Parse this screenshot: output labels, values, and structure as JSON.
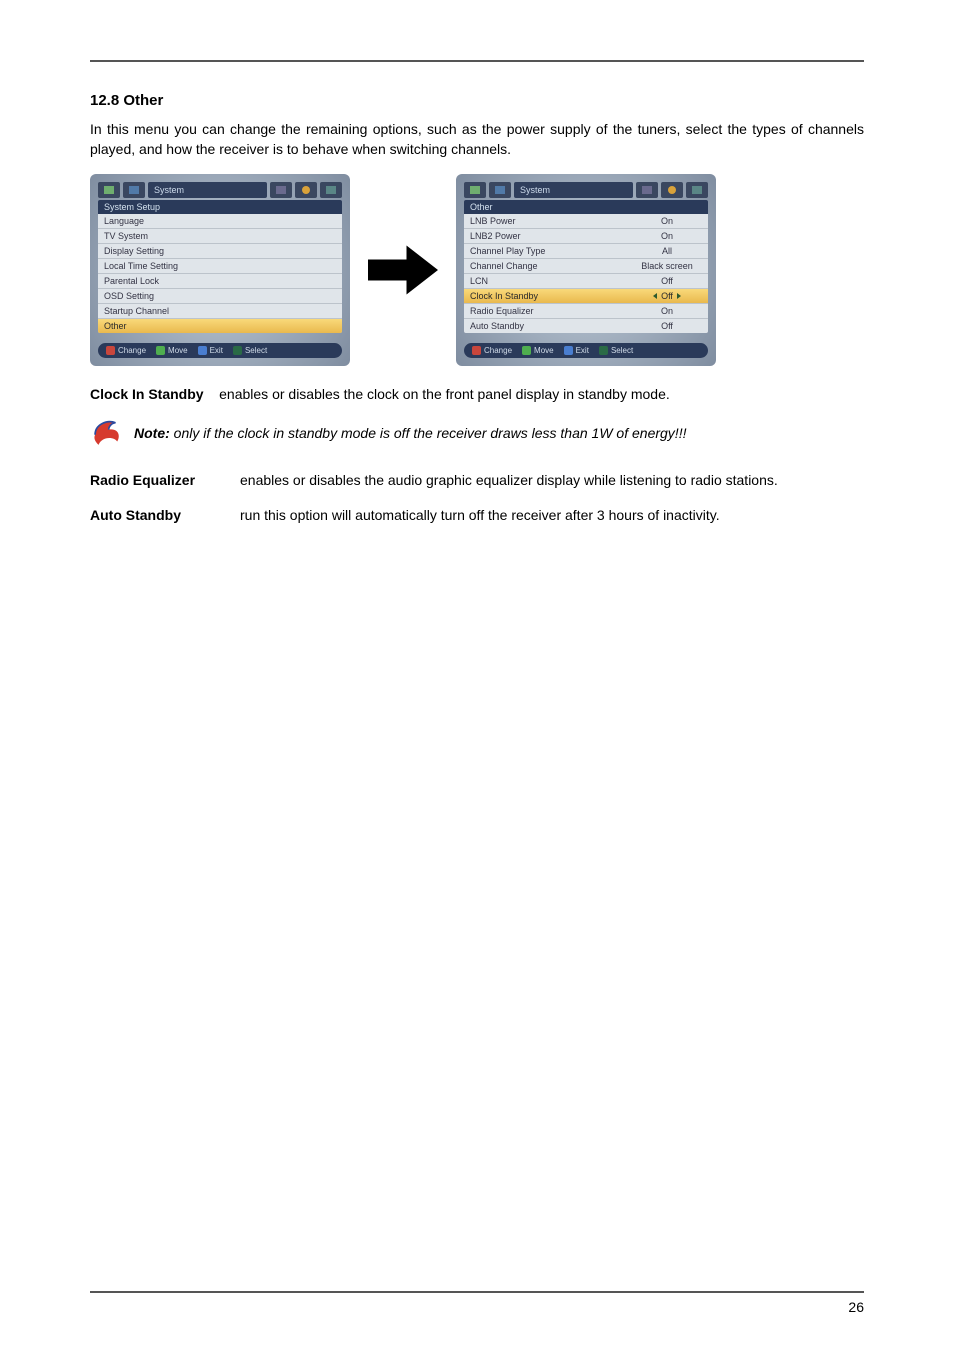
{
  "section": {
    "heading": "12.8 Other",
    "intro": "In this menu you can change the remaining options, such as the power supply of the tuners, select the types of channels played, and how the receiver is to behave when switching channels."
  },
  "left_panel": {
    "tab_group_title": "System",
    "header": "System Setup",
    "items": [
      {
        "label": "Language"
      },
      {
        "label": "TV System"
      },
      {
        "label": "Display Setting"
      },
      {
        "label": "Local Time Setting"
      },
      {
        "label": "Parental Lock"
      },
      {
        "label": "OSD Setting"
      },
      {
        "label": "Startup Channel"
      },
      {
        "label": "Other"
      }
    ],
    "selected_index": 7,
    "footer": {
      "change": "Change",
      "move": "Move",
      "exit": "Exit",
      "select": "Select"
    }
  },
  "right_panel": {
    "tab_group_title": "System",
    "header": "Other",
    "items": [
      {
        "label": "LNB Power",
        "value": "On"
      },
      {
        "label": "LNB2 Power",
        "value": "On"
      },
      {
        "label": "Channel Play Type",
        "value": "All"
      },
      {
        "label": "Channel Change",
        "value": "Black screen"
      },
      {
        "label": "LCN",
        "value": "Off"
      },
      {
        "label": "Clock In Standby",
        "value": "Off"
      },
      {
        "label": "Radio Equalizer",
        "value": "On"
      },
      {
        "label": "Auto Standby",
        "value": "Off"
      }
    ],
    "selected_index": 5,
    "footer": {
      "change": "Change",
      "move": "Move",
      "exit": "Exit",
      "select": "Select"
    }
  },
  "definitions": {
    "clock_in_standby": {
      "term": "Clock In Standby",
      "desc": "enables or disables the clock on the front panel display in standby mode."
    },
    "note": {
      "label": "Note:",
      "text": "only if the clock in standby mode is off the receiver draws less than 1W of energy!!!"
    },
    "radio_equalizer": {
      "term": "Radio Equalizer",
      "desc": "enables or disables the audio graphic equalizer display while listening to radio stations."
    },
    "auto_standby": {
      "term": "Auto Standby",
      "desc": "run this option will automatically turn off the receiver after 3 hours of inactivity."
    }
  },
  "page_number": "26"
}
